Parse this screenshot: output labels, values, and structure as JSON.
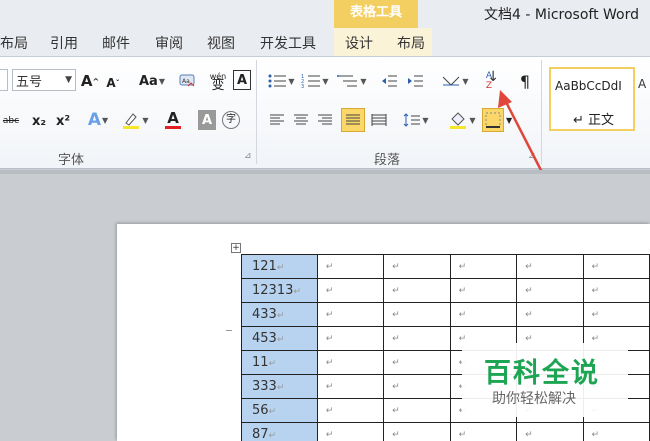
{
  "titlebar": {
    "context_tab_group": "表格工具",
    "document_title": "文档4 - Microsoft Word"
  },
  "tabs": [
    {
      "label": "布局"
    },
    {
      "label": "引用"
    },
    {
      "label": "邮件"
    },
    {
      "label": "审阅"
    },
    {
      "label": "视图"
    },
    {
      "label": "开发工具"
    },
    {
      "label": "设计"
    },
    {
      "label": "布局"
    }
  ],
  "ribbon": {
    "font_group": {
      "label": "字体",
      "font_size": "五号",
      "grow_font": "A",
      "shrink_font": "A",
      "change_case": "Aa",
      "phonetic": "wén",
      "enclose_char": "变",
      "char_border": "A",
      "strikethrough": "abc",
      "subscript": "x₂",
      "superscript": "x²",
      "text_effect": "A",
      "highlight_color": "#f7e62b",
      "font_color": "#e02020",
      "char_shading": "A",
      "enclosed_circle": "字"
    },
    "paragraph_group": {
      "label": "段落",
      "sort_button": "A Z",
      "show_marks": "¶",
      "shading_color": "#f7e62b"
    },
    "styles_group": {
      "style_sample": "AaBbCcDdI",
      "style_name": "正文",
      "next_sample": "A"
    }
  },
  "annotation_color": "#e0463a",
  "document": {
    "table": {
      "first_column": [
        "121",
        "12313",
        "433",
        "453",
        "11",
        "333",
        "56",
        "87"
      ],
      "paragraph_mark": "↵",
      "column_count": 6
    }
  },
  "watermark": {
    "main": "百科全说",
    "sub": "助你轻松解决",
    "color": "#1ea553"
  }
}
